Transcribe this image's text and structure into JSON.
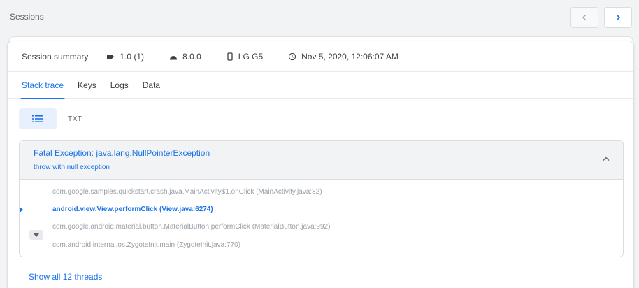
{
  "header": {
    "title": "Sessions",
    "prev_icon": "chevron-left-icon",
    "next_icon": "chevron-right-icon"
  },
  "summary": {
    "label": "Session summary",
    "version": "1.0 (1)",
    "os": "8.0.0",
    "device": "LG G5",
    "timestamp": "Nov 5, 2020, 12:06:07 AM",
    "icons": [
      "label-icon",
      "android-icon",
      "phone-icon",
      "clock-icon"
    ]
  },
  "tabs": [
    {
      "label": "Stack trace",
      "active": true
    },
    {
      "label": "Keys",
      "active": false
    },
    {
      "label": "Logs",
      "active": false
    },
    {
      "label": "Data",
      "active": false
    }
  ],
  "view_toggle": {
    "list_icon": "list-icon",
    "txt_label": "TXT"
  },
  "exception": {
    "title": "Fatal Exception: java.lang.NullPointerException",
    "subtitle": "throw with null exception",
    "collapse_icon": "chevron-up-icon",
    "frames": [
      {
        "text": "com.google.samples.quickstart.crash.java.MainActivity$1.onClick (MainActivity.java:82)",
        "highlight": false
      },
      {
        "text": "android.view.View.performClick (View.java:6274)",
        "highlight": true
      },
      {
        "text": "com.google.android.material.button.MaterialButton.performClick (MaterialButton.java:992)",
        "highlight": false
      },
      {
        "text": "com.android.internal.os.ZygoteInit.main (ZygoteInit.java:770)",
        "highlight": false
      }
    ]
  },
  "footer": {
    "show_threads": "Show all 12 threads"
  },
  "colors": {
    "accent": "#1a73e8",
    "muted_text": "#9aa0a6",
    "background": "#f1f3f4"
  }
}
